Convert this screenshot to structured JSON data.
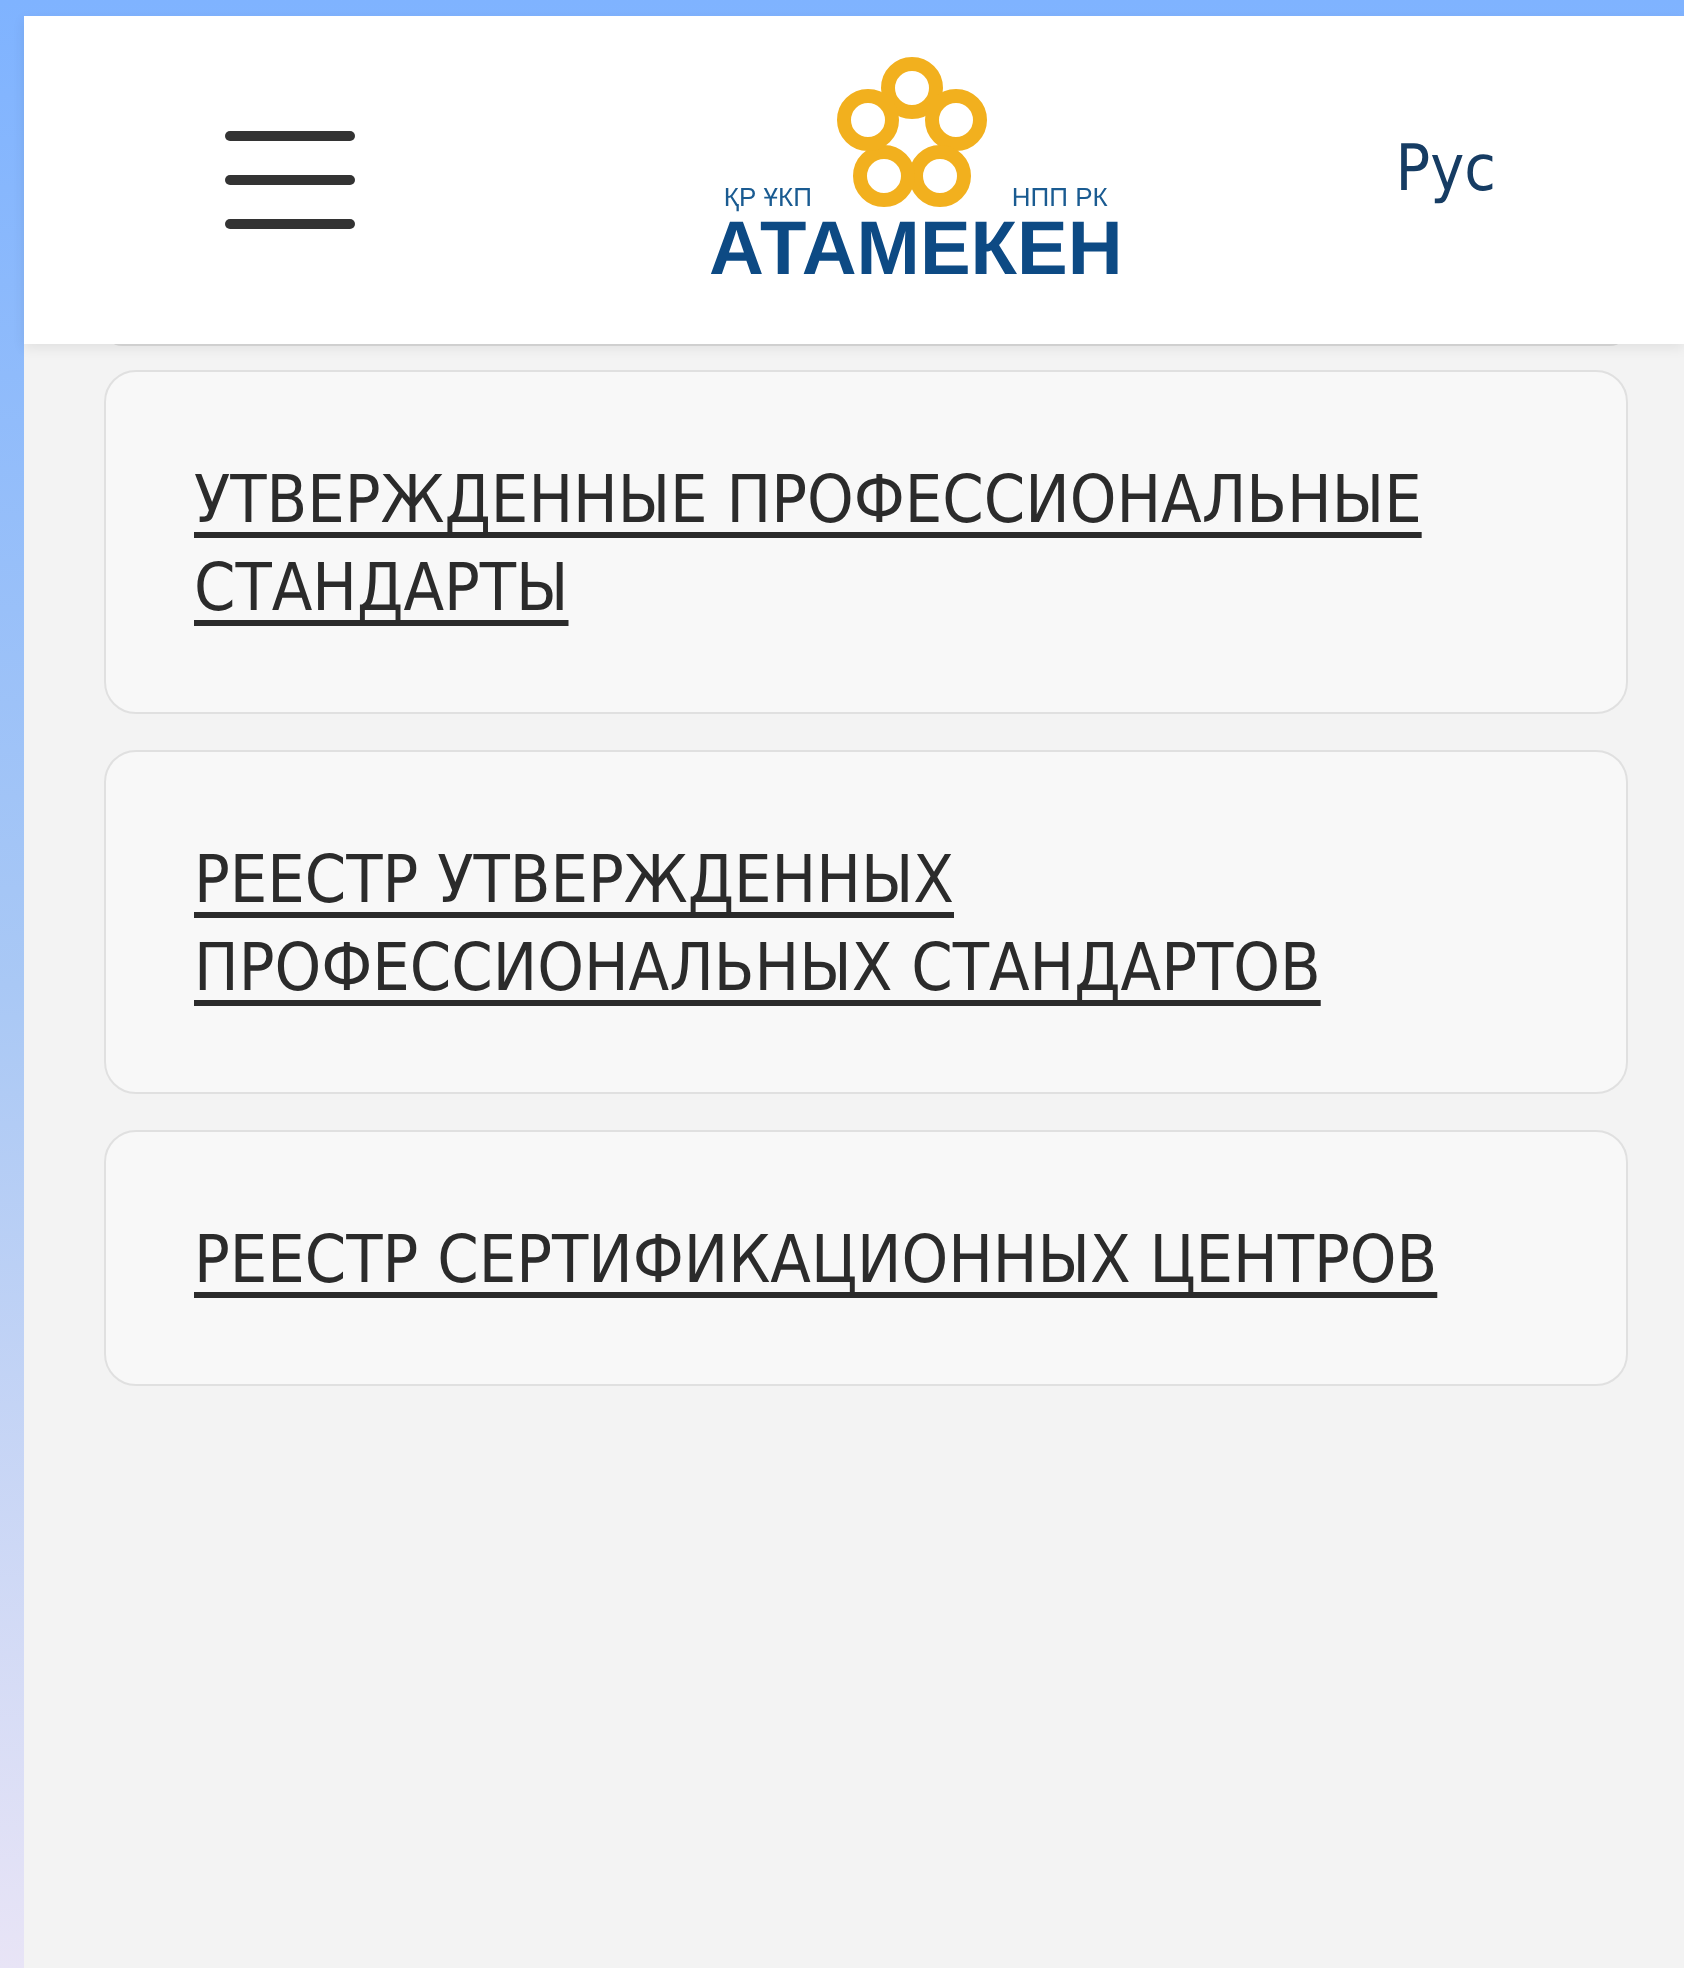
{
  "header": {
    "logo": {
      "left_caption": "ҚР ҰКП",
      "right_caption": "НПП РК",
      "name": "АТАМЕКЕН"
    },
    "language": "Рус"
  },
  "links": [
    {
      "label": "УТВЕРЖДЕННЫЕ ПРОФЕССИОНАЛЬНЫЕ СТАНДАРТЫ"
    },
    {
      "label": "РЕЕСТР УТВЕРЖДЕННЫХ ПРОФЕССИОНАЛЬНЫХ СТАНДАРТОВ"
    },
    {
      "label": "РЕЕСТР СЕРТИФИКАЦИОННЫХ ЦЕНТРОВ"
    }
  ]
}
